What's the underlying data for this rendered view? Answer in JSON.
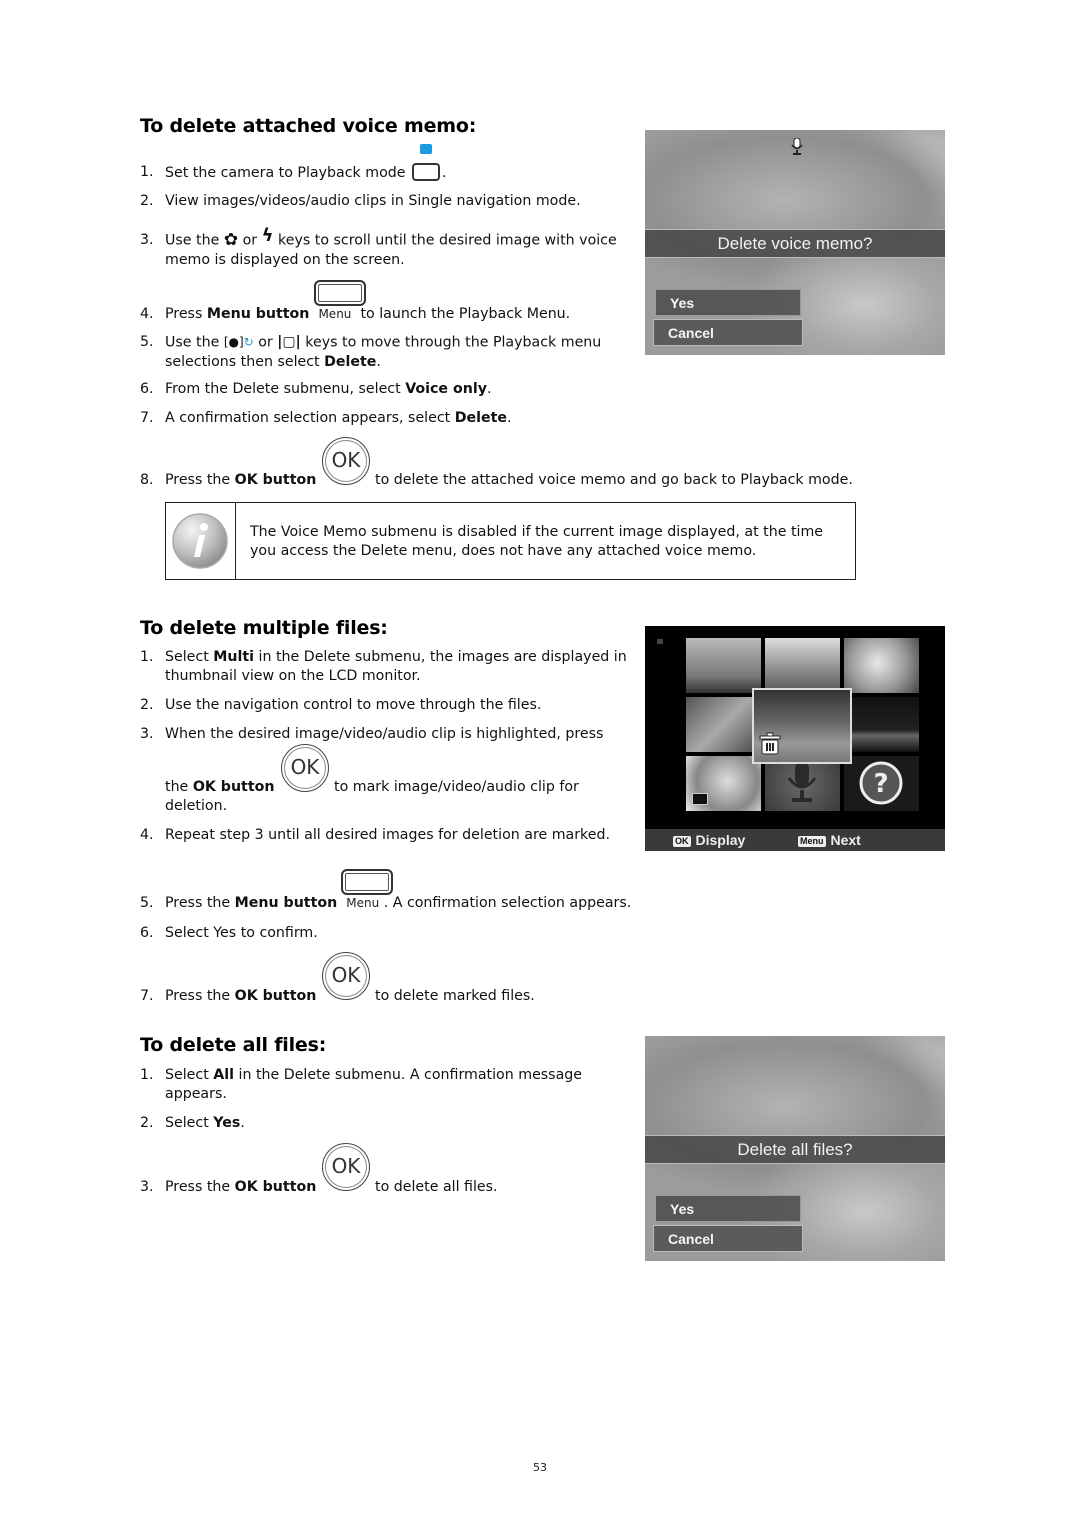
{
  "sections": {
    "voice_memo": {
      "title": "To delete attached voice memo:",
      "steps": [
        {
          "num": "1.",
          "a": "Set the camera to Playback mode",
          "b": "."
        },
        {
          "num": "2.",
          "a": "View images/videos/audio clips in Single navigation mode."
        },
        {
          "num": "3.",
          "a": "Use the",
          "b": "or",
          "c": "keys to scroll until the desired image with voice",
          "d": "memo is displayed on the screen."
        },
        {
          "num": "4.",
          "a": "Press",
          "bold": "Menu button",
          "key": "Menu",
          "b": "to launch the Playback Menu."
        },
        {
          "num": "5.",
          "a": "Use the",
          "b": "or",
          "c": "keys to move through the Playback menu",
          "d": "selections then select",
          "bold": "Delete",
          "e": "."
        },
        {
          "num": "6.",
          "a": "From the Delete submenu, select",
          "bold": "Voice only",
          "b": "."
        },
        {
          "num": "7.",
          "a": "A confirmation selection appears, select",
          "bold": "Delete",
          "b": "."
        },
        {
          "num": "8.",
          "a": "Press the",
          "bold": "OK button",
          "key": "OK",
          "b": "to delete the attached voice memo and go back to Playback mode."
        }
      ],
      "note": "The Voice Memo submenu is disabled if the current image displayed, at the time you access the Delete menu, does not have any attached voice memo.",
      "screen": {
        "prompt": "Delete voice memo?",
        "options": [
          "Yes",
          "Cancel"
        ],
        "highlighted": "Cancel"
      }
    },
    "multiple": {
      "title": "To delete multiple files:",
      "steps": [
        {
          "num": "1.",
          "a": "Select",
          "bold": "Multi",
          "b": "in the Delete submenu, the images are displayed in",
          "c": "thumbnail view on the LCD monitor."
        },
        {
          "num": "2.",
          "a": "Use the navigation control to move through the files."
        },
        {
          "num": "3.",
          "a": "When the desired image/video/audio clip is highlighted, press",
          "b": "the",
          "bold": "OK button",
          "key": "OK",
          "c": "to mark image/video/audio clip for",
          "d": "deletion."
        },
        {
          "num": "4.",
          "a": "Repeat step 3 until all desired images for deletion are marked."
        },
        {
          "num": "5.",
          "a": "Press the",
          "bold": "Menu button",
          "key": "Menu",
          "b": ". A confirmation selection appears."
        },
        {
          "num": "6.",
          "a": "Select Yes to confirm."
        },
        {
          "num": "7.",
          "a": "Press the",
          "bold": "OK button",
          "key": "OK",
          "b": "to delete marked files."
        }
      ],
      "screen": {
        "ok_chip": "OK",
        "ok_label": "Display",
        "menu_chip": "Menu",
        "menu_label": "Next"
      }
    },
    "all": {
      "title": "To delete all files:",
      "steps": [
        {
          "num": "1.",
          "a": "Select",
          "bold": "All",
          "b": "in the Delete submenu. A confirmation message",
          "c": "appears."
        },
        {
          "num": "2.",
          "a": "Select",
          "bold": "Yes",
          "b": "."
        },
        {
          "num": "3.",
          "a": "Press the",
          "bold": "OK button",
          "key": "OK",
          "b": "to delete all files."
        }
      ],
      "screen": {
        "prompt": "Delete all files?",
        "options": [
          "Yes",
          "Cancel"
        ],
        "highlighted": "Cancel"
      }
    }
  },
  "page_number": "53"
}
